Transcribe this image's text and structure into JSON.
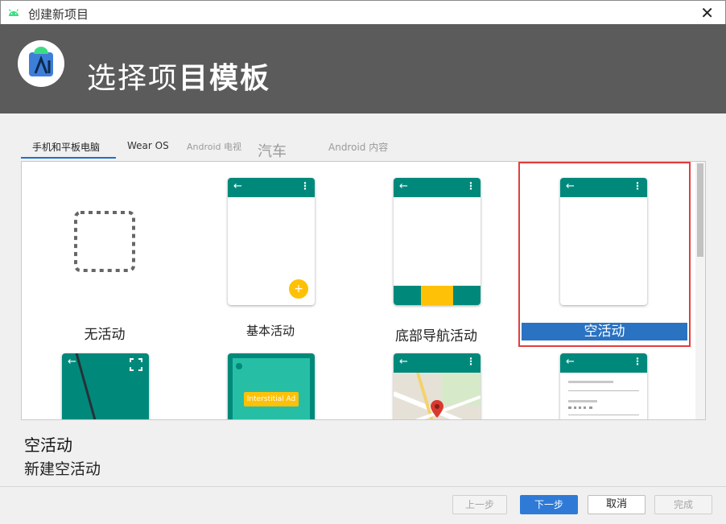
{
  "window": {
    "title": "创建新项目"
  },
  "header": {
    "heading_regular": "选择项",
    "heading_bold": "目模板"
  },
  "tabs": [
    {
      "label": "手机和平板电脑",
      "state": "active"
    },
    {
      "label": "Wear OS",
      "state": "normal"
    },
    {
      "label": "Android 电视",
      "state": "disabled"
    },
    {
      "label": "汽车",
      "state": "disabled"
    },
    {
      "label": "Android 内容",
      "state": "disabled"
    }
  ],
  "templates": [
    {
      "label": "无活动",
      "selected": false
    },
    {
      "label": "基本活动",
      "selected": false
    },
    {
      "label": "底部导航活动",
      "selected": false
    },
    {
      "label": "空活动",
      "selected": true
    },
    {
      "label": "",
      "selected": false
    },
    {
      "label": "",
      "selected": false
    },
    {
      "label": "",
      "selected": false
    },
    {
      "label": "",
      "selected": false
    }
  ],
  "interstitial_label": "Interstitial Ad",
  "selection": {
    "title": "空活动",
    "description": "新建空活动"
  },
  "buttons": {
    "previous": "上一步",
    "next": "下一步",
    "cancel": "取消",
    "finish": "完成"
  },
  "icons": {
    "close": "close-icon",
    "android": "android-icon",
    "back": "back-arrow-icon",
    "overflow": "overflow-menu-icon",
    "fab": "add-icon",
    "fullscreen": "fullscreen-icon",
    "map_pin": "map-pin-icon"
  },
  "colors": {
    "header_bg": "#5b5b5b",
    "app_bar": "#00897b",
    "accent_yellow": "#ffc107",
    "selected_label_bg": "#2a72c2",
    "selection_outline": "#e33d3d",
    "primary_button": "#2f7ad6"
  }
}
